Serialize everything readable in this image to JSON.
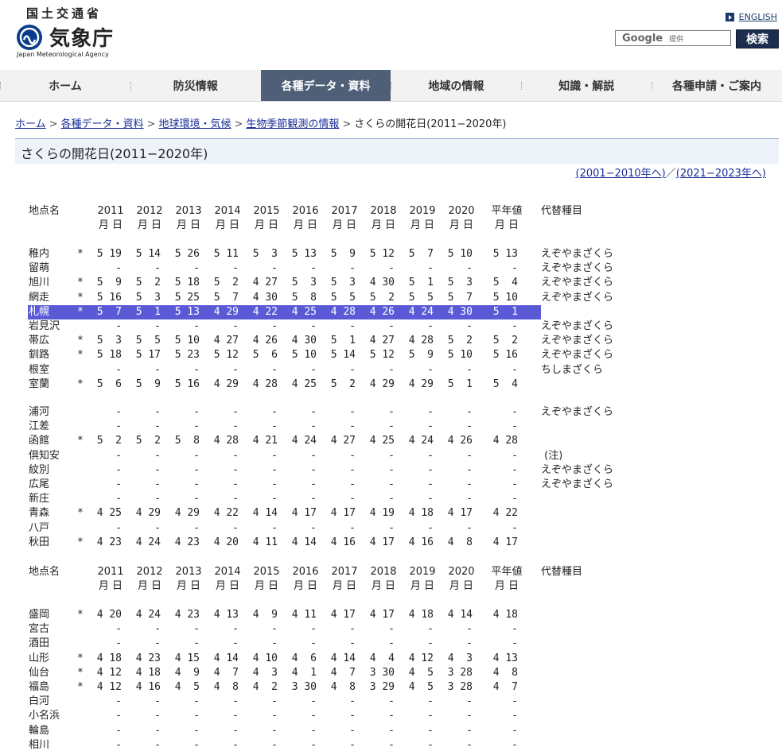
{
  "header": {
    "ministry": "国土交通省",
    "agency": "気象庁",
    "agency_en": "Japan Meteorological Agency",
    "english_link": "ENGLISH",
    "search_brand": "Google",
    "search_provided": "提供",
    "search_button": "検索"
  },
  "nav": [
    {
      "label": "ホーム",
      "active": false
    },
    {
      "label": "防災情報",
      "active": false
    },
    {
      "label": "各種データ・資料",
      "active": true
    },
    {
      "label": "地域の情報",
      "active": false
    },
    {
      "label": "知識・解説",
      "active": false
    },
    {
      "label": "各種申請・ご案内",
      "active": false
    }
  ],
  "breadcrumb": {
    "items": [
      "ホーム",
      "各種データ・資料",
      "地球環境・気候",
      "生物季節観測の情報"
    ],
    "current": "さくらの開花日(2011−2020年)"
  },
  "page_title": "さくらの開花日(2011−2020年)",
  "period_links": {
    "prev": "(2001−2010年へ)",
    "sep": "／",
    "next": "(2021−2023年へ)"
  },
  "colors": {
    "nav_active": "#4e5f77",
    "highlight": "#5a5ad6",
    "link": "#1a2f98",
    "title_bg": "#eef3fa"
  },
  "table": {
    "header_name": "地点名",
    "years": [
      "2011",
      "2012",
      "2013",
      "2014",
      "2015",
      "2016",
      "2017",
      "2018",
      "2019",
      "2020",
      "平年値"
    ],
    "md": "月 日",
    "alt_header": "代替種目",
    "sections": [
      {
        "rows": [
          {
            "name": "稚内",
            "mark": "*",
            "vals": [
              "5 19",
              "5 14",
              "5 26",
              "5 11",
              "5  3",
              "5 13",
              "5  9",
              "5 12",
              "5  7",
              "5 10",
              "5 13"
            ],
            "alt": "えぞやまざくら"
          },
          {
            "name": "留萌",
            "mark": "",
            "vals": [
              "-",
              "-",
              "-",
              "-",
              "-",
              "-",
              "-",
              "-",
              "-",
              "-",
              "-"
            ],
            "alt": "えぞやまざくら"
          },
          {
            "name": "旭川",
            "mark": "*",
            "vals": [
              "5  9",
              "5  2",
              "5 18",
              "5  2",
              "4 27",
              "5  3",
              "5  3",
              "4 30",
              "5  1",
              "5  3",
              "5  4"
            ],
            "alt": "えぞやまざくら"
          },
          {
            "name": "網走",
            "mark": "*",
            "vals": [
              "5 16",
              "5  3",
              "5 25",
              "5  7",
              "4 30",
              "5  8",
              "5  5",
              "5  2",
              "5  5",
              "5  7",
              "5 10"
            ],
            "alt": "えぞやまざくら"
          },
          {
            "name": "札幌",
            "mark": "*",
            "vals": [
              "5  7",
              "5  1",
              "5 13",
              "4 29",
              "4 22",
              "4 25",
              "4 28",
              "4 26",
              "4 24",
              "4 30",
              "5  1"
            ],
            "alt": "",
            "highlight": true
          },
          {
            "name": "岩見沢",
            "mark": "",
            "vals": [
              "-",
              "-",
              "-",
              "-",
              "-",
              "-",
              "-",
              "-",
              "-",
              "-",
              "-"
            ],
            "alt": "えぞやまざくら"
          },
          {
            "name": "帯広",
            "mark": "*",
            "vals": [
              "5  3",
              "5  5",
              "5 10",
              "4 27",
              "4 26",
              "4 30",
              "5  1",
              "4 27",
              "4 28",
              "5  2",
              "5  2"
            ],
            "alt": "えぞやまざくら"
          },
          {
            "name": "釧路",
            "mark": "*",
            "vals": [
              "5 18",
              "5 17",
              "5 23",
              "5 12",
              "5  6",
              "5 10",
              "5 14",
              "5 12",
              "5  9",
              "5 10",
              "5 16"
            ],
            "alt": "えぞやまざくら"
          },
          {
            "name": "根室",
            "mark": "",
            "vals": [
              "-",
              "-",
              "-",
              "-",
              "-",
              "-",
              "-",
              "-",
              "-",
              "-",
              "-"
            ],
            "alt": "ちしまざくら"
          },
          {
            "name": "室蘭",
            "mark": "*",
            "vals": [
              "5  6",
              "5  9",
              "5 16",
              "4 29",
              "4 28",
              "4 25",
              "5  2",
              "4 29",
              "4 29",
              "5  1",
              "5  4"
            ],
            "alt": ""
          }
        ]
      },
      {
        "rows": [
          {
            "name": "浦河",
            "mark": "",
            "vals": [
              "-",
              "-",
              "-",
              "-",
              "-",
              "-",
              "-",
              "-",
              "-",
              "-",
              "-"
            ],
            "alt": "えぞやまざくら"
          },
          {
            "name": "江差",
            "mark": "",
            "vals": [
              "-",
              "-",
              "-",
              "-",
              "-",
              "-",
              "-",
              "-",
              "-",
              "-",
              "-"
            ],
            "alt": ""
          },
          {
            "name": "函館",
            "mark": "*",
            "vals": [
              "5  2",
              "5  2",
              "5  8",
              "4 28",
              "4 21",
              "4 24",
              "4 27",
              "4 25",
              "4 24",
              "4 26",
              "4 28"
            ],
            "alt": ""
          },
          {
            "name": "倶知安",
            "mark": "",
            "vals": [
              "-",
              "-",
              "-",
              "-",
              "-",
              "-",
              "-",
              "-",
              "-",
              "-",
              "-"
            ],
            "alt": " (注)"
          },
          {
            "name": "紋別",
            "mark": "",
            "vals": [
              "-",
              "-",
              "-",
              "-",
              "-",
              "-",
              "-",
              "-",
              "-",
              "-",
              "-"
            ],
            "alt": "えぞやまざくら"
          },
          {
            "name": "広尾",
            "mark": "",
            "vals": [
              "-",
              "-",
              "-",
              "-",
              "-",
              "-",
              "-",
              "-",
              "-",
              "-",
              "-"
            ],
            "alt": "えぞやまざくら"
          },
          {
            "name": "新庄",
            "mark": "",
            "vals": [
              "-",
              "-",
              "-",
              "-",
              "-",
              "-",
              "-",
              "-",
              "-",
              "-",
              "-"
            ],
            "alt": ""
          },
          {
            "name": "青森",
            "mark": "*",
            "vals": [
              "4 25",
              "4 29",
              "4 29",
              "4 22",
              "4 14",
              "4 17",
              "4 17",
              "4 19",
              "4 18",
              "4 17",
              "4 22"
            ],
            "alt": ""
          },
          {
            "name": "八戸",
            "mark": "",
            "vals": [
              "-",
              "-",
              "-",
              "-",
              "-",
              "-",
              "-",
              "-",
              "-",
              "-",
              "-"
            ],
            "alt": ""
          },
          {
            "name": "秋田",
            "mark": "*",
            "vals": [
              "4 23",
              "4 24",
              "4 23",
              "4 20",
              "4 11",
              "4 14",
              "4 16",
              "4 17",
              "4 16",
              "4  8",
              "4 17"
            ],
            "alt": ""
          }
        ]
      },
      {
        "rows": [
          {
            "name": "盛岡",
            "mark": "*",
            "vals": [
              "4 20",
              "4 24",
              "4 23",
              "4 13",
              "4  9",
              "4 11",
              "4 17",
              "4 17",
              "4 18",
              "4 14",
              "4 18"
            ],
            "alt": ""
          },
          {
            "name": "宮古",
            "mark": "",
            "vals": [
              "-",
              "-",
              "-",
              "-",
              "-",
              "-",
              "-",
              "-",
              "-",
              "-",
              "-"
            ],
            "alt": ""
          },
          {
            "name": "酒田",
            "mark": "",
            "vals": [
              "-",
              "-",
              "-",
              "-",
              "-",
              "-",
              "-",
              "-",
              "-",
              "-",
              "-"
            ],
            "alt": ""
          },
          {
            "name": "山形",
            "mark": "*",
            "vals": [
              "4 18",
              "4 23",
              "4 15",
              "4 14",
              "4 10",
              "4  6",
              "4 14",
              "4  4",
              "4 12",
              "4  3",
              "4 13"
            ],
            "alt": ""
          },
          {
            "name": "仙台",
            "mark": "*",
            "vals": [
              "4 12",
              "4 18",
              "4  9",
              "4  7",
              "4  3",
              "4  1",
              "4  7",
              "3 30",
              "4  5",
              "3 28",
              "4  8"
            ],
            "alt": ""
          },
          {
            "name": "福島",
            "mark": "*",
            "vals": [
              "4 12",
              "4 16",
              "4  5",
              "4  8",
              "4  2",
              "3 30",
              "4  8",
              "3 29",
              "4  5",
              "3 28",
              "4  7"
            ],
            "alt": ""
          },
          {
            "name": "白河",
            "mark": "",
            "vals": [
              "-",
              "-",
              "-",
              "-",
              "-",
              "-",
              "-",
              "-",
              "-",
              "-",
              "-"
            ],
            "alt": ""
          },
          {
            "name": "小名浜",
            "mark": "",
            "vals": [
              "-",
              "-",
              "-",
              "-",
              "-",
              "-",
              "-",
              "-",
              "-",
              "-",
              "-"
            ],
            "alt": ""
          },
          {
            "name": "輪島",
            "mark": "",
            "vals": [
              "-",
              "-",
              "-",
              "-",
              "-",
              "-",
              "-",
              "-",
              "-",
              "-",
              "-"
            ],
            "alt": ""
          },
          {
            "name": "相川",
            "mark": "",
            "vals": [
              "-",
              "-",
              "-",
              "-",
              "-",
              "-",
              "-",
              "-",
              "-",
              "-",
              "-"
            ],
            "alt": ""
          }
        ]
      }
    ]
  }
}
